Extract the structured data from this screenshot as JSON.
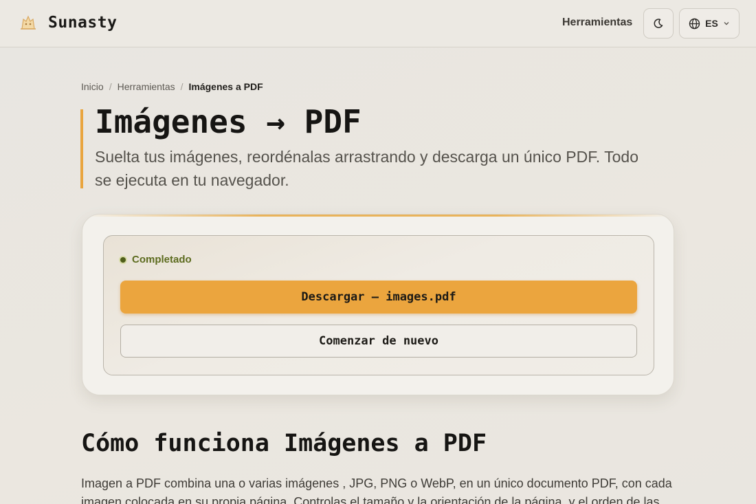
{
  "header": {
    "brand": "Sunasty",
    "nav_tools": "Herramientas",
    "language": "ES"
  },
  "breadcrumb": {
    "home": "Inicio",
    "tools": "Herramientas",
    "current": "Imágenes a PDF"
  },
  "page": {
    "title": "Imágenes → PDF",
    "subtitle": "Suelta tus imágenes, reordénalas arrastrando y descarga un único PDF. Todo se ejecuta en tu navegador."
  },
  "result": {
    "status": "Completado",
    "download_label": "Descargar — images.pdf",
    "restart_label": "Comenzar de nuevo"
  },
  "section": {
    "title": "Cómo funciona Imágenes a PDF",
    "body": "Imagen a PDF combina una o varias imágenes , JPG, PNG o WebP, en un único documento PDF, con cada imagen colocada en su propia página. Controlas el tamaño y la orientación de la página, y el orden de las"
  },
  "colors": {
    "accent": "#eba53e",
    "status_green": "#5c6b1e"
  },
  "icons": [
    "logo-icon",
    "moon-icon",
    "globe-icon",
    "chevron-down-icon"
  ]
}
